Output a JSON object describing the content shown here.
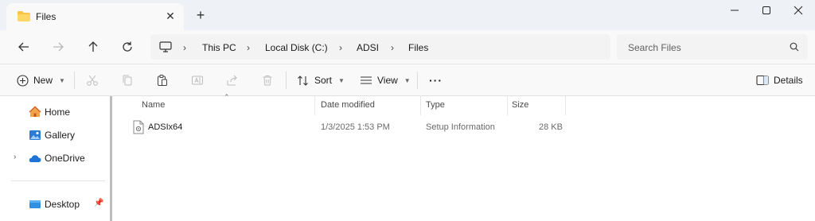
{
  "window": {
    "tab_title": "Files",
    "new_tab_symbol": "+"
  },
  "address_bar": {
    "crumbs": [
      "This PC",
      "Local Disk (C:)",
      "ADSI",
      "Files"
    ],
    "separator": "›"
  },
  "search": {
    "placeholder": "Search Files"
  },
  "command_bar": {
    "new_label": "New",
    "sort_label": "Sort",
    "view_label": "View",
    "more_label": "···",
    "details_label": "Details"
  },
  "sidebar": {
    "items": [
      {
        "label": "Home",
        "icon": "home-icon"
      },
      {
        "label": "Gallery",
        "icon": "gallery-icon"
      },
      {
        "label": "OneDrive",
        "icon": "onedrive-icon",
        "expandable": true
      },
      {
        "label": "Desktop",
        "icon": "desktop-icon",
        "pinned": true
      }
    ]
  },
  "file_list": {
    "columns": [
      "Name",
      "Date modified",
      "Type",
      "Size"
    ],
    "rows": [
      {
        "name": "ADSIx64",
        "date_modified": "1/3/2025 1:53 PM",
        "type": "Setup Information",
        "size": "28 KB"
      }
    ]
  },
  "colors": {
    "accent": "#0067c0",
    "folder": "#f7c544",
    "window_bg": "#eef1f5"
  }
}
